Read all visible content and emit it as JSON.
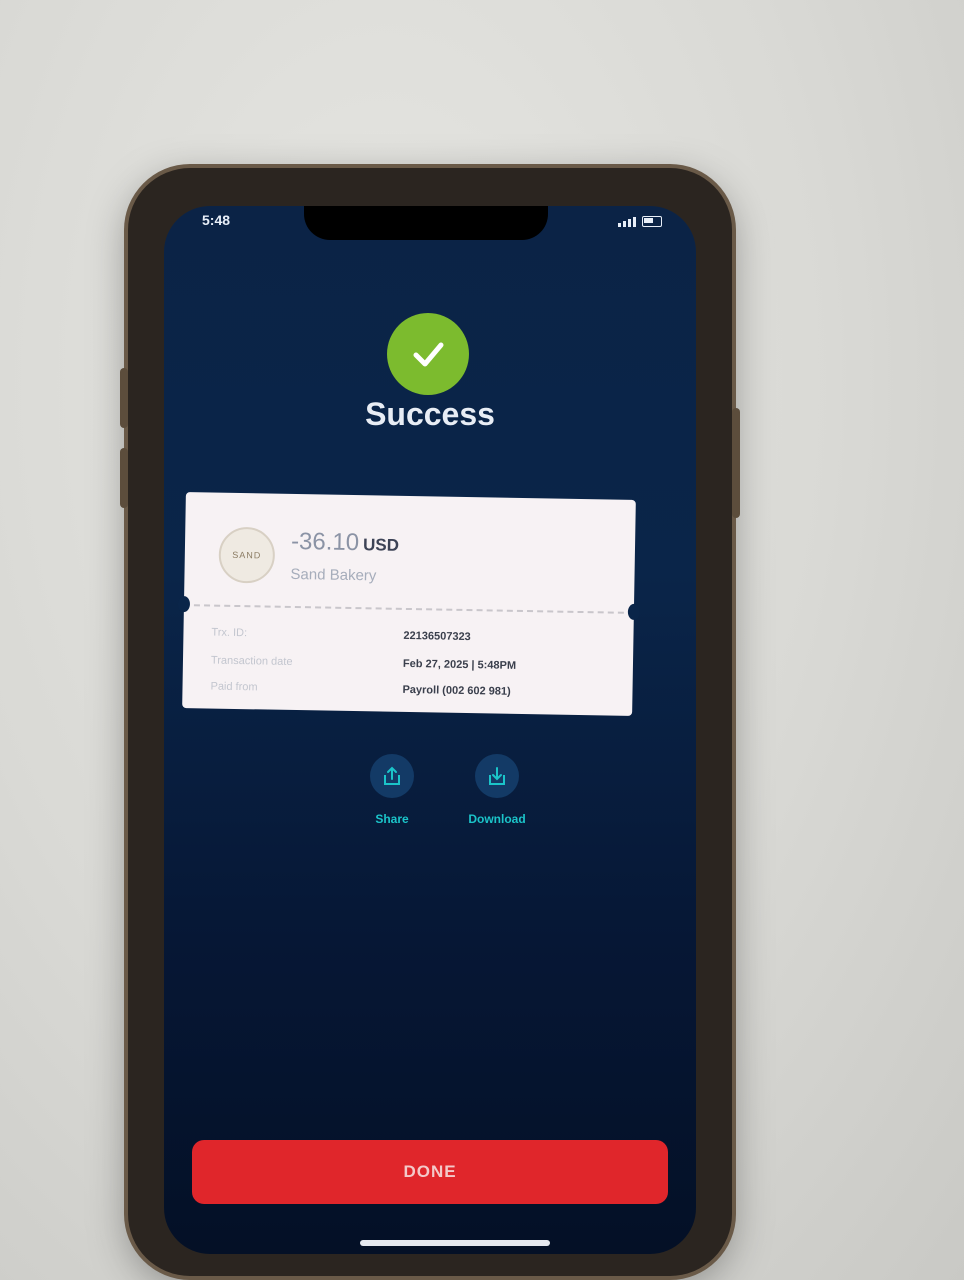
{
  "status_bar": {
    "time": "5:48"
  },
  "header": {
    "title": "Success"
  },
  "receipt": {
    "amount": "-36.10",
    "currency": "USD",
    "merchant": "Sand Bakery",
    "logo_text": "SAND",
    "rows": [
      {
        "label": "Trx. ID:",
        "value": "22136507323"
      },
      {
        "label": "Transaction date",
        "value": "Feb 27, 2025 | 5:48PM"
      },
      {
        "label": "Paid from",
        "value": "Payroll (002 602 981)"
      }
    ]
  },
  "actions": {
    "share_label": "Share",
    "download_label": "Download"
  },
  "done_button": {
    "label": "DONE"
  },
  "colors": {
    "success": "#7cbb2e",
    "accent": "#1bc4c9",
    "done": "#e0262b",
    "background": "#0a2549"
  },
  "icons": [
    "checkmark-icon",
    "share-icon",
    "download-icon",
    "signal-icon",
    "battery-icon"
  ]
}
